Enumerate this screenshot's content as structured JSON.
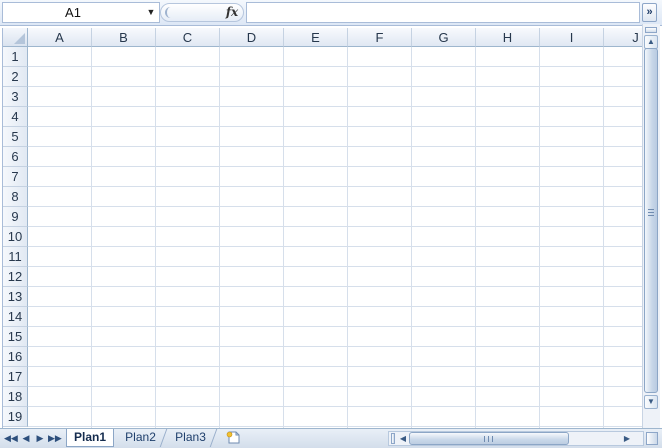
{
  "formula_bar": {
    "name_box_value": "A1",
    "name_box_arrow": "▼",
    "fx_label": "fx",
    "formula_value": "",
    "expand_label": "»"
  },
  "grid": {
    "columns": [
      "A",
      "B",
      "C",
      "D",
      "E",
      "F",
      "G",
      "H",
      "I",
      "J"
    ],
    "rows": [
      "1",
      "2",
      "3",
      "4",
      "5",
      "6",
      "7",
      "8",
      "9",
      "10",
      "11",
      "12",
      "13",
      "14",
      "15",
      "16",
      "17",
      "18",
      "19"
    ]
  },
  "sheet_tabs": {
    "nav": [
      "◀◀",
      "◀",
      "▶",
      "▶▶"
    ],
    "tabs": [
      {
        "label": "Plan1",
        "active": true
      },
      {
        "label": "Plan2",
        "active": false
      },
      {
        "label": "Plan3",
        "active": false
      }
    ],
    "new_sheet_icon": "new-sheet-icon"
  },
  "scrollbars": {
    "up": "▲",
    "down": "▼",
    "left": "◀",
    "right": "▶"
  },
  "colors": {
    "header_border": "#9eb6ce",
    "gridline": "#d6dfeb",
    "accent": "#1f3f6c"
  }
}
